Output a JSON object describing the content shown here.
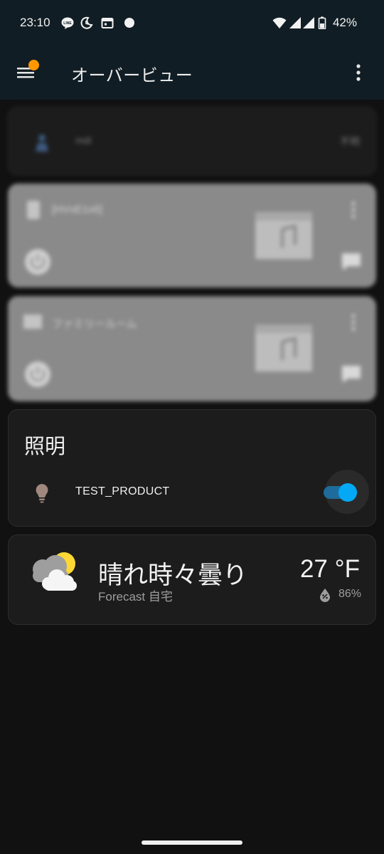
{
  "status_bar": {
    "time": "23:10",
    "battery_percent": "42%",
    "icons": [
      "line-icon",
      "do-not-disturb-icon",
      "calendar-icon",
      "dot-icon",
      "wifi-icon",
      "signal-icon",
      "signal-icon",
      "battery-icon"
    ]
  },
  "app_bar": {
    "title": "オーバービュー"
  },
  "blurred_cards": [
    {
      "name": "mdi",
      "value": "不明"
    },
    {
      "name": "[HVxE1x6]"
    },
    {
      "name": "ファミリールーム"
    }
  ],
  "lighting_card": {
    "title": "照明",
    "entity": "TEST_PRODUCT",
    "toggle_on": true
  },
  "weather_card": {
    "condition": "晴れ時々曇り",
    "subtitle": "Forecast 自宅",
    "temperature": "27 °F",
    "humidity": "86%"
  },
  "colors": {
    "background": "#111111",
    "header": "#111d24",
    "card": "#1c1c1c",
    "accent": "#03a9f4",
    "badge": "#ff9800"
  }
}
